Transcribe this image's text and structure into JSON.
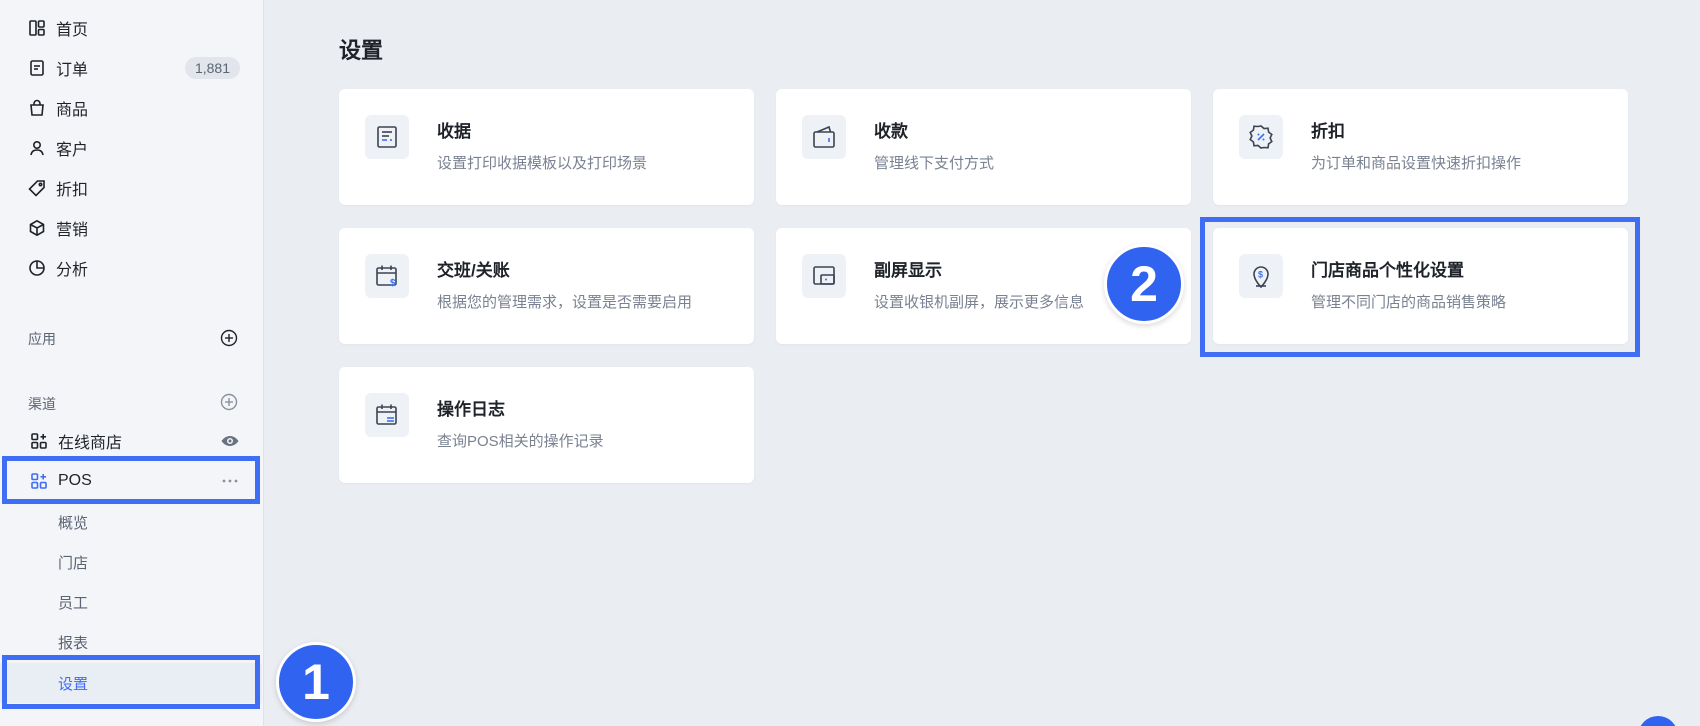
{
  "sidebar": {
    "nav": [
      {
        "label": "首页",
        "icon": "dashboard-icon"
      },
      {
        "label": "订单",
        "icon": "order-icon",
        "badge": "1,881"
      },
      {
        "label": "商品",
        "icon": "bag-icon"
      },
      {
        "label": "客户",
        "icon": "user-icon"
      },
      {
        "label": "折扣",
        "icon": "tag-icon"
      },
      {
        "label": "营销",
        "icon": "box-icon"
      },
      {
        "label": "分析",
        "icon": "pie-chart-icon"
      }
    ],
    "apps_label": "应用",
    "channels_label": "渠道",
    "channels": [
      {
        "label": "在线商店",
        "icon": "store-apps-icon",
        "trail_icon": "eye-icon"
      },
      {
        "label": "POS",
        "icon": "pos-apps-icon",
        "trail_icon": "more-icon"
      }
    ],
    "pos_sub": [
      {
        "label": "概览"
      },
      {
        "label": "门店"
      },
      {
        "label": "员工"
      },
      {
        "label": "报表"
      },
      {
        "label": "设置"
      }
    ]
  },
  "main": {
    "title": "设置",
    "cards": [
      {
        "title": "收据",
        "desc": "设置打印收据模板以及打印场景",
        "icon": "receipt-icon"
      },
      {
        "title": "收款",
        "desc": "管理线下支付方式",
        "icon": "wallet-icon"
      },
      {
        "title": "折扣",
        "desc": "为订单和商品设置快速折扣操作",
        "icon": "discount-badge-icon"
      },
      {
        "title": "交班/关账",
        "desc": "根据您的管理需求，设置是否需要启用",
        "icon": "calendar-dollar-icon"
      },
      {
        "title": "副屏显示",
        "desc": "设置收银机副屏，展示更多信息",
        "icon": "second-screen-icon"
      },
      {
        "title": "门店商品个性化设置",
        "desc": "管理不同门店的商品销售策略",
        "icon": "location-dollar-icon"
      },
      {
        "title": "操作日志",
        "desc": "查询POS相关的操作记录",
        "icon": "calendar-log-icon"
      }
    ]
  },
  "annotations": {
    "step1": "1",
    "step2": "2"
  },
  "colors": {
    "accent": "#3f6df3",
    "marker": "#2f63f0",
    "sidebar_bg": "#f3f5f8",
    "main_bg": "#eaedf2"
  }
}
